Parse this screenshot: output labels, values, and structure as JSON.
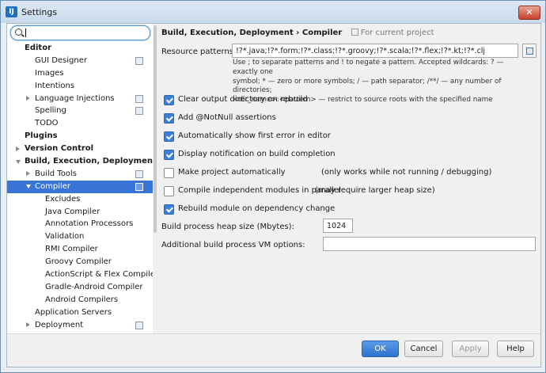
{
  "window": {
    "title": "Settings",
    "close_label": "✕"
  },
  "search": {
    "value": ""
  },
  "sidebar": {
    "items": [
      {
        "label": "Editor",
        "level": 1,
        "bold": true
      },
      {
        "label": "GUI Designer",
        "level": 2,
        "proj": true
      },
      {
        "label": "Images",
        "level": 2
      },
      {
        "label": "Intentions",
        "level": 2
      },
      {
        "label": "Language Injections",
        "level": 2,
        "arrow": "right",
        "proj": true
      },
      {
        "label": "Spelling",
        "level": 2,
        "proj": true
      },
      {
        "label": "TODO",
        "level": 2
      },
      {
        "label": "Plugins",
        "level": 1,
        "bold": true
      },
      {
        "label": "Version Control",
        "level": 1,
        "bold": true,
        "arrow": "right"
      },
      {
        "label": "Build, Execution, Deployment",
        "level": 1,
        "bold": true,
        "arrow": "down"
      },
      {
        "label": "Build Tools",
        "level": 2,
        "arrow": "right",
        "proj": true
      },
      {
        "label": "Compiler",
        "level": 2,
        "arrow": "down",
        "proj": true,
        "selected": true
      },
      {
        "label": "Excludes",
        "level": 3
      },
      {
        "label": "Java Compiler",
        "level": 3
      },
      {
        "label": "Annotation Processors",
        "level": 3
      },
      {
        "label": "Validation",
        "level": 3
      },
      {
        "label": "RMI Compiler",
        "level": 3
      },
      {
        "label": "Groovy Compiler",
        "level": 3
      },
      {
        "label": "ActionScript & Flex Compiler",
        "level": 3
      },
      {
        "label": "Gradle-Android Compiler",
        "level": 3
      },
      {
        "label": "Android Compilers",
        "level": 3
      },
      {
        "label": "Application Servers",
        "level": 2
      },
      {
        "label": "Deployment",
        "level": 2,
        "arrow": "right",
        "proj": true
      }
    ]
  },
  "main": {
    "breadcrumb": "Build, Execution, Deployment › Compiler",
    "scope": "For current project",
    "resource_label": "Resource patterns:",
    "resource_value": "!?*.java;!?*.form;!?*.class;!?*.groovy;!?*.scala;!?*.flex;!?*.kt;!?*.clj",
    "hint_1": "Use ; to separate patterns and ! to negate a pattern. Accepted wildcards: ? — exactly one",
    "hint_2": "symbol; * — zero or more symbols; / — path separator; /**/ — any number of directories;",
    "hint_3": "<dir_name>:<pattern> — restrict to source roots with the specified name",
    "options": [
      {
        "label": "Clear output directory on rebuild",
        "checked": true,
        "note": ""
      },
      {
        "label": "Add @NotNull assertions",
        "checked": true,
        "note": ""
      },
      {
        "label": "Automatically show first error in editor",
        "checked": true,
        "note": ""
      },
      {
        "label": "Display notification on build completion",
        "checked": true,
        "note": ""
      },
      {
        "label": "Make project automatically",
        "checked": false,
        "note": "(only works while not running / debugging)"
      },
      {
        "label": "Compile independent modules in parallel",
        "checked": false,
        "note": "(may require larger heap size)"
      },
      {
        "label": "Rebuild module on dependency change",
        "checked": true,
        "note": ""
      }
    ],
    "heap_label": "Build process heap size (Mbytes):",
    "heap_value": "1024",
    "vm_label": "Additional build process VM options:",
    "vm_value": ""
  },
  "footer": {
    "ok": "OK",
    "cancel": "Cancel",
    "apply": "Apply",
    "help": "Help"
  },
  "colors": {
    "selection": "#3875d6",
    "primary": "#3a7fd9",
    "checkbox": "#3b7fd6"
  }
}
